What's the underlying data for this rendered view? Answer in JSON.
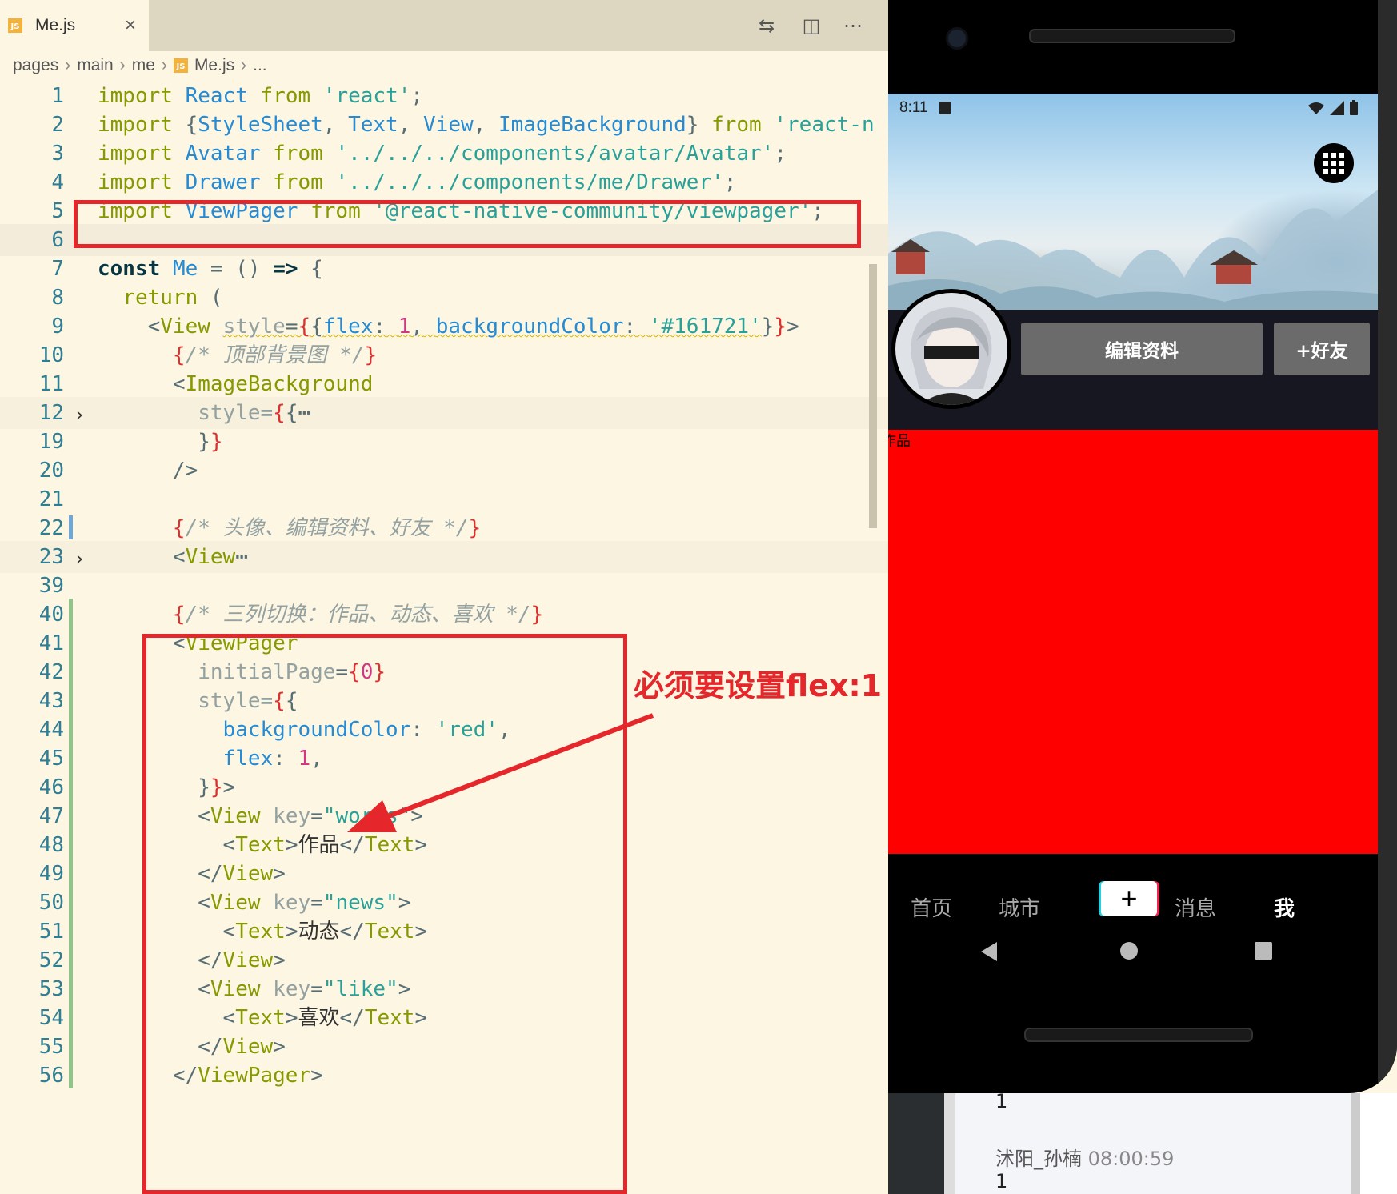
{
  "editor": {
    "tab": {
      "title": "Me.js",
      "close": "×"
    },
    "toolbar": {
      "compare_icon": "⇆",
      "split_icon": "◫",
      "more_icon": "⋯"
    },
    "breadcrumb": [
      "pages",
      "main",
      "me",
      "Me.js",
      "..."
    ],
    "line_numbers": [
      "1",
      "2",
      "3",
      "4",
      "5",
      "6",
      "7",
      "8",
      "9",
      "10",
      "11",
      "12",
      "19",
      "20",
      "21",
      "22",
      "23",
      "39",
      "40",
      "41",
      "42",
      "43",
      "44",
      "45",
      "46",
      "47",
      "48",
      "49",
      "50",
      "51",
      "52",
      "53",
      "54",
      "55",
      "56"
    ],
    "annotation": "必须要设置flex:1"
  },
  "phone": {
    "status": {
      "time": "8:11"
    },
    "edit_profile": "编辑资料",
    "add_friend": "+好友",
    "pager_text": "作品",
    "nav": {
      "home": "首页",
      "city": "城市",
      "plus": "+",
      "messages": "消息",
      "me": "我"
    }
  },
  "chat": {
    "line1": "1",
    "name": "沭阳_孙楠",
    "time": "08:00:59",
    "line2": "1"
  },
  "colors": {
    "accent_red": "#e5262a",
    "pager_bg": "#ff0000",
    "screen_bg": "#161721"
  }
}
